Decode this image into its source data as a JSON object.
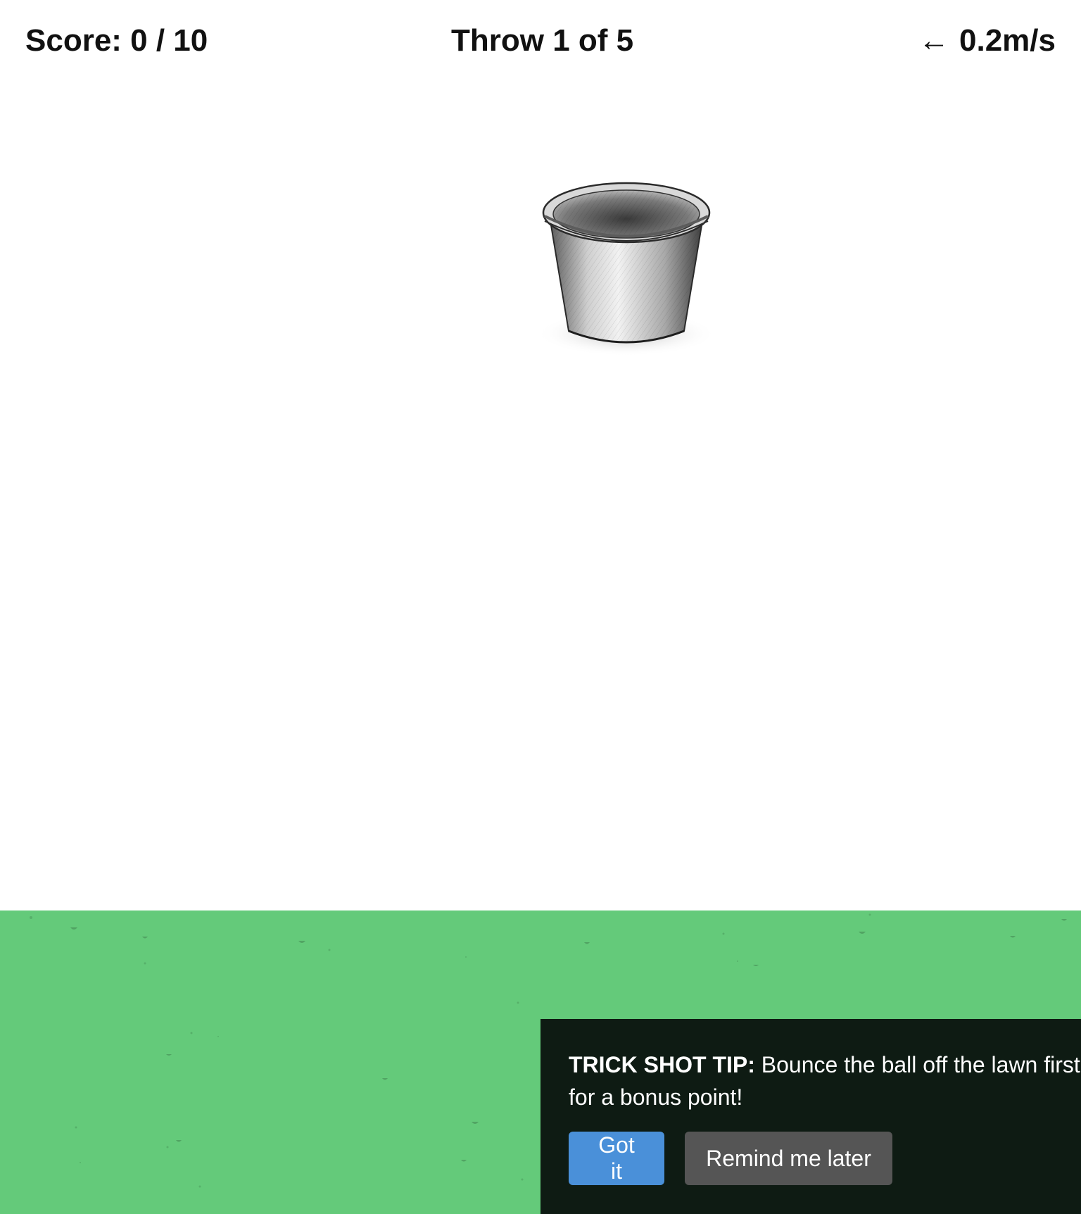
{
  "hud": {
    "score": "Score: 0 / 10",
    "throw": "Throw 1 of 5",
    "wind_arrow": "←",
    "wind_speed": "0.2m/s"
  },
  "tip": {
    "lead": "TRICK SHOT TIP:",
    "body": " Bounce the ball off the lawn first for a bonus point!",
    "primary_button": "Got it",
    "secondary_button": "Remind me later"
  },
  "colors": {
    "lawn": "#64ca7a",
    "tip_background": "#0e1b13",
    "primary_button": "#4a90d9",
    "secondary_button": "#555555"
  },
  "icons": {
    "wind": "left-arrow-icon",
    "target": "bucket-target"
  }
}
